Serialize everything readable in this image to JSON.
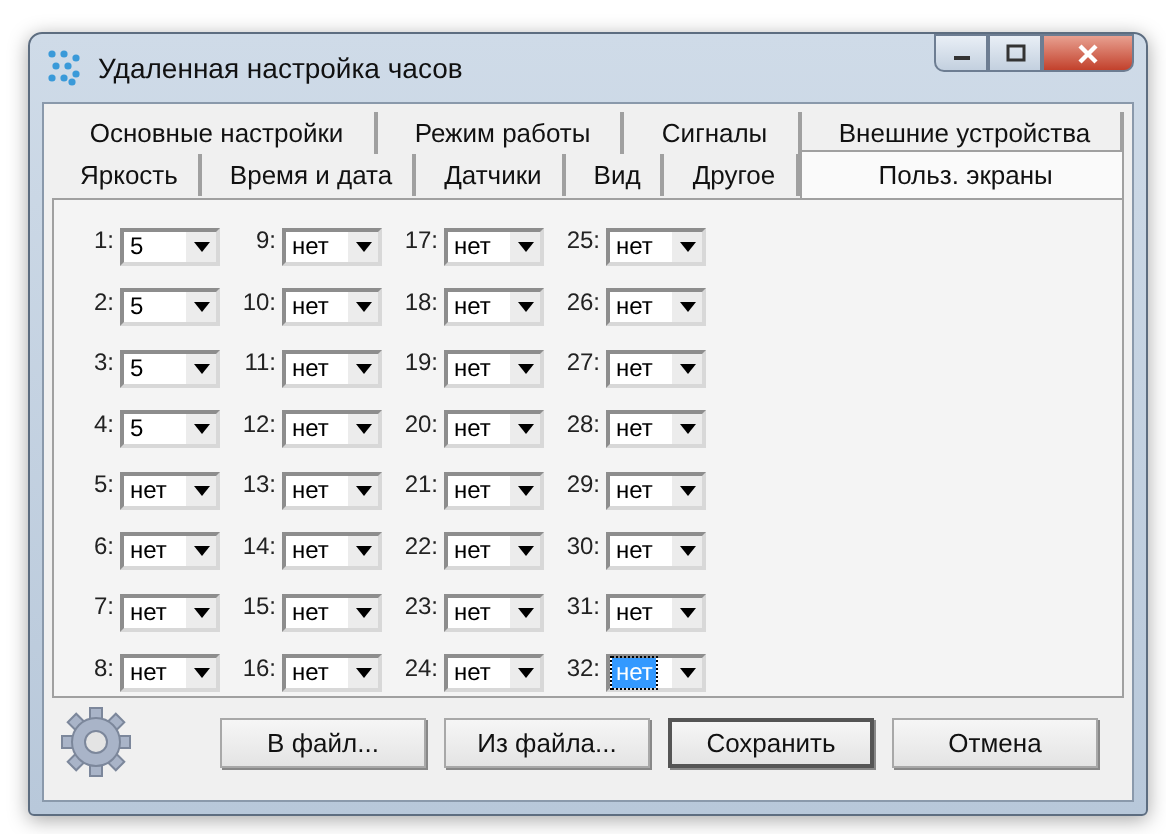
{
  "window": {
    "title": "Удаленная настройка часов"
  },
  "tab_rows": [
    [
      {
        "label": "Основные настройки",
        "selected": false
      },
      {
        "label": "Режим работы",
        "selected": false
      },
      {
        "label": "Сигналы",
        "selected": false
      },
      {
        "label": "Внешние устройства",
        "selected": false
      }
    ],
    [
      {
        "label": "Яркость",
        "selected": false
      },
      {
        "label": "Время и дата",
        "selected": false
      },
      {
        "label": "Датчики",
        "selected": false
      },
      {
        "label": "Вид",
        "selected": false
      },
      {
        "label": "Другое",
        "selected": false
      },
      {
        "label": "Польз. экраны",
        "selected": true
      }
    ]
  ],
  "screens": [
    {
      "label": "1:",
      "value": "5",
      "focused": false
    },
    {
      "label": "2:",
      "value": "5",
      "focused": false
    },
    {
      "label": "3:",
      "value": "5",
      "focused": false
    },
    {
      "label": "4:",
      "value": "5",
      "focused": false
    },
    {
      "label": "5:",
      "value": "нет",
      "focused": false
    },
    {
      "label": "6:",
      "value": "нет",
      "focused": false
    },
    {
      "label": "7:",
      "value": "нет",
      "focused": false
    },
    {
      "label": "8:",
      "value": "нет",
      "focused": false
    },
    {
      "label": "9:",
      "value": "нет",
      "focused": false
    },
    {
      "label": "10:",
      "value": "нет",
      "focused": false
    },
    {
      "label": "11:",
      "value": "нет",
      "focused": false
    },
    {
      "label": "12:",
      "value": "нет",
      "focused": false
    },
    {
      "label": "13:",
      "value": "нет",
      "focused": false
    },
    {
      "label": "14:",
      "value": "нет",
      "focused": false
    },
    {
      "label": "15:",
      "value": "нет",
      "focused": false
    },
    {
      "label": "16:",
      "value": "нет",
      "focused": false
    },
    {
      "label": "17:",
      "value": "нет",
      "focused": false
    },
    {
      "label": "18:",
      "value": "нет",
      "focused": false
    },
    {
      "label": "19:",
      "value": "нет",
      "focused": false
    },
    {
      "label": "20:",
      "value": "нет",
      "focused": false
    },
    {
      "label": "21:",
      "value": "нет",
      "focused": false
    },
    {
      "label": "22:",
      "value": "нет",
      "focused": false
    },
    {
      "label": "23:",
      "value": "нет",
      "focused": false
    },
    {
      "label": "24:",
      "value": "нет",
      "focused": false
    },
    {
      "label": "25:",
      "value": "нет",
      "focused": false
    },
    {
      "label": "26:",
      "value": "нет",
      "focused": false
    },
    {
      "label": "27:",
      "value": "нет",
      "focused": false
    },
    {
      "label": "28:",
      "value": "нет",
      "focused": false
    },
    {
      "label": "29:",
      "value": "нет",
      "focused": false
    },
    {
      "label": "30:",
      "value": "нет",
      "focused": false
    },
    {
      "label": "31:",
      "value": "нет",
      "focused": false
    },
    {
      "label": "32:",
      "value": "нет",
      "focused": true
    }
  ],
  "buttons": [
    {
      "label": "В файл...",
      "default": false
    },
    {
      "label": "Из файла...",
      "default": false
    },
    {
      "label": "Сохранить",
      "default": true
    },
    {
      "label": "Отмена",
      "default": false
    }
  ]
}
